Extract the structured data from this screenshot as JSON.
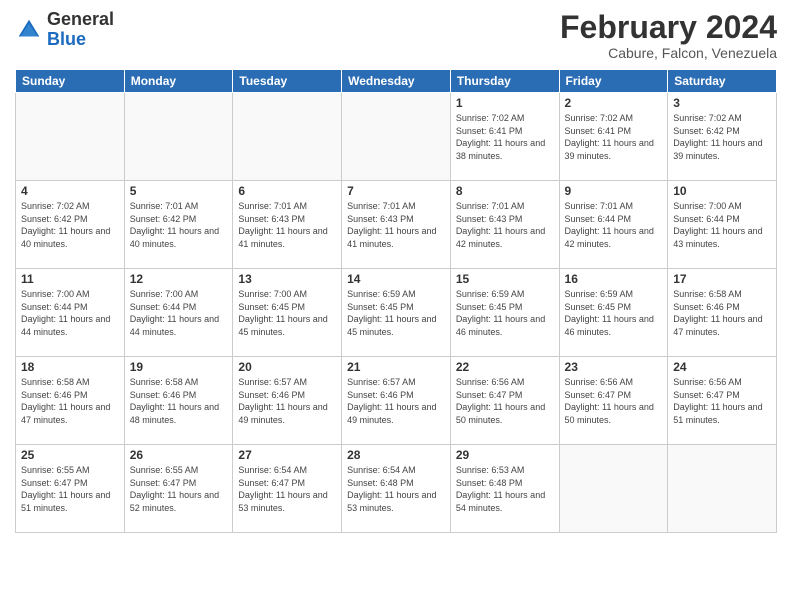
{
  "header": {
    "logo_general": "General",
    "logo_blue": "Blue",
    "month_title": "February 2024",
    "location": "Cabure, Falcon, Venezuela"
  },
  "days_of_week": [
    "Sunday",
    "Monday",
    "Tuesday",
    "Wednesday",
    "Thursday",
    "Friday",
    "Saturday"
  ],
  "weeks": [
    [
      {
        "day": "",
        "sunrise": "",
        "sunset": "",
        "daylight": "",
        "empty": true
      },
      {
        "day": "",
        "sunrise": "",
        "sunset": "",
        "daylight": "",
        "empty": true
      },
      {
        "day": "",
        "sunrise": "",
        "sunset": "",
        "daylight": "",
        "empty": true
      },
      {
        "day": "",
        "sunrise": "",
        "sunset": "",
        "daylight": "",
        "empty": true
      },
      {
        "day": "1",
        "sunrise": "Sunrise: 7:02 AM",
        "sunset": "Sunset: 6:41 PM",
        "daylight": "Daylight: 11 hours and 38 minutes.",
        "empty": false
      },
      {
        "day": "2",
        "sunrise": "Sunrise: 7:02 AM",
        "sunset": "Sunset: 6:41 PM",
        "daylight": "Daylight: 11 hours and 39 minutes.",
        "empty": false
      },
      {
        "day": "3",
        "sunrise": "Sunrise: 7:02 AM",
        "sunset": "Sunset: 6:42 PM",
        "daylight": "Daylight: 11 hours and 39 minutes.",
        "empty": false
      }
    ],
    [
      {
        "day": "4",
        "sunrise": "Sunrise: 7:02 AM",
        "sunset": "Sunset: 6:42 PM",
        "daylight": "Daylight: 11 hours and 40 minutes.",
        "empty": false
      },
      {
        "day": "5",
        "sunrise": "Sunrise: 7:01 AM",
        "sunset": "Sunset: 6:42 PM",
        "daylight": "Daylight: 11 hours and 40 minutes.",
        "empty": false
      },
      {
        "day": "6",
        "sunrise": "Sunrise: 7:01 AM",
        "sunset": "Sunset: 6:43 PM",
        "daylight": "Daylight: 11 hours and 41 minutes.",
        "empty": false
      },
      {
        "day": "7",
        "sunrise": "Sunrise: 7:01 AM",
        "sunset": "Sunset: 6:43 PM",
        "daylight": "Daylight: 11 hours and 41 minutes.",
        "empty": false
      },
      {
        "day": "8",
        "sunrise": "Sunrise: 7:01 AM",
        "sunset": "Sunset: 6:43 PM",
        "daylight": "Daylight: 11 hours and 42 minutes.",
        "empty": false
      },
      {
        "day": "9",
        "sunrise": "Sunrise: 7:01 AM",
        "sunset": "Sunset: 6:44 PM",
        "daylight": "Daylight: 11 hours and 42 minutes.",
        "empty": false
      },
      {
        "day": "10",
        "sunrise": "Sunrise: 7:00 AM",
        "sunset": "Sunset: 6:44 PM",
        "daylight": "Daylight: 11 hours and 43 minutes.",
        "empty": false
      }
    ],
    [
      {
        "day": "11",
        "sunrise": "Sunrise: 7:00 AM",
        "sunset": "Sunset: 6:44 PM",
        "daylight": "Daylight: 11 hours and 44 minutes.",
        "empty": false
      },
      {
        "day": "12",
        "sunrise": "Sunrise: 7:00 AM",
        "sunset": "Sunset: 6:44 PM",
        "daylight": "Daylight: 11 hours and 44 minutes.",
        "empty": false
      },
      {
        "day": "13",
        "sunrise": "Sunrise: 7:00 AM",
        "sunset": "Sunset: 6:45 PM",
        "daylight": "Daylight: 11 hours and 45 minutes.",
        "empty": false
      },
      {
        "day": "14",
        "sunrise": "Sunrise: 6:59 AM",
        "sunset": "Sunset: 6:45 PM",
        "daylight": "Daylight: 11 hours and 45 minutes.",
        "empty": false
      },
      {
        "day": "15",
        "sunrise": "Sunrise: 6:59 AM",
        "sunset": "Sunset: 6:45 PM",
        "daylight": "Daylight: 11 hours and 46 minutes.",
        "empty": false
      },
      {
        "day": "16",
        "sunrise": "Sunrise: 6:59 AM",
        "sunset": "Sunset: 6:45 PM",
        "daylight": "Daylight: 11 hours and 46 minutes.",
        "empty": false
      },
      {
        "day": "17",
        "sunrise": "Sunrise: 6:58 AM",
        "sunset": "Sunset: 6:46 PM",
        "daylight": "Daylight: 11 hours and 47 minutes.",
        "empty": false
      }
    ],
    [
      {
        "day": "18",
        "sunrise": "Sunrise: 6:58 AM",
        "sunset": "Sunset: 6:46 PM",
        "daylight": "Daylight: 11 hours and 47 minutes.",
        "empty": false
      },
      {
        "day": "19",
        "sunrise": "Sunrise: 6:58 AM",
        "sunset": "Sunset: 6:46 PM",
        "daylight": "Daylight: 11 hours and 48 minutes.",
        "empty": false
      },
      {
        "day": "20",
        "sunrise": "Sunrise: 6:57 AM",
        "sunset": "Sunset: 6:46 PM",
        "daylight": "Daylight: 11 hours and 49 minutes.",
        "empty": false
      },
      {
        "day": "21",
        "sunrise": "Sunrise: 6:57 AM",
        "sunset": "Sunset: 6:46 PM",
        "daylight": "Daylight: 11 hours and 49 minutes.",
        "empty": false
      },
      {
        "day": "22",
        "sunrise": "Sunrise: 6:56 AM",
        "sunset": "Sunset: 6:47 PM",
        "daylight": "Daylight: 11 hours and 50 minutes.",
        "empty": false
      },
      {
        "day": "23",
        "sunrise": "Sunrise: 6:56 AM",
        "sunset": "Sunset: 6:47 PM",
        "daylight": "Daylight: 11 hours and 50 minutes.",
        "empty": false
      },
      {
        "day": "24",
        "sunrise": "Sunrise: 6:56 AM",
        "sunset": "Sunset: 6:47 PM",
        "daylight": "Daylight: 11 hours and 51 minutes.",
        "empty": false
      }
    ],
    [
      {
        "day": "25",
        "sunrise": "Sunrise: 6:55 AM",
        "sunset": "Sunset: 6:47 PM",
        "daylight": "Daylight: 11 hours and 51 minutes.",
        "empty": false
      },
      {
        "day": "26",
        "sunrise": "Sunrise: 6:55 AM",
        "sunset": "Sunset: 6:47 PM",
        "daylight": "Daylight: 11 hours and 52 minutes.",
        "empty": false
      },
      {
        "day": "27",
        "sunrise": "Sunrise: 6:54 AM",
        "sunset": "Sunset: 6:47 PM",
        "daylight": "Daylight: 11 hours and 53 minutes.",
        "empty": false
      },
      {
        "day": "28",
        "sunrise": "Sunrise: 6:54 AM",
        "sunset": "Sunset: 6:48 PM",
        "daylight": "Daylight: 11 hours and 53 minutes.",
        "empty": false
      },
      {
        "day": "29",
        "sunrise": "Sunrise: 6:53 AM",
        "sunset": "Sunset: 6:48 PM",
        "daylight": "Daylight: 11 hours and 54 minutes.",
        "empty": false
      },
      {
        "day": "",
        "sunrise": "",
        "sunset": "",
        "daylight": "",
        "empty": true
      },
      {
        "day": "",
        "sunrise": "",
        "sunset": "",
        "daylight": "",
        "empty": true
      }
    ]
  ]
}
